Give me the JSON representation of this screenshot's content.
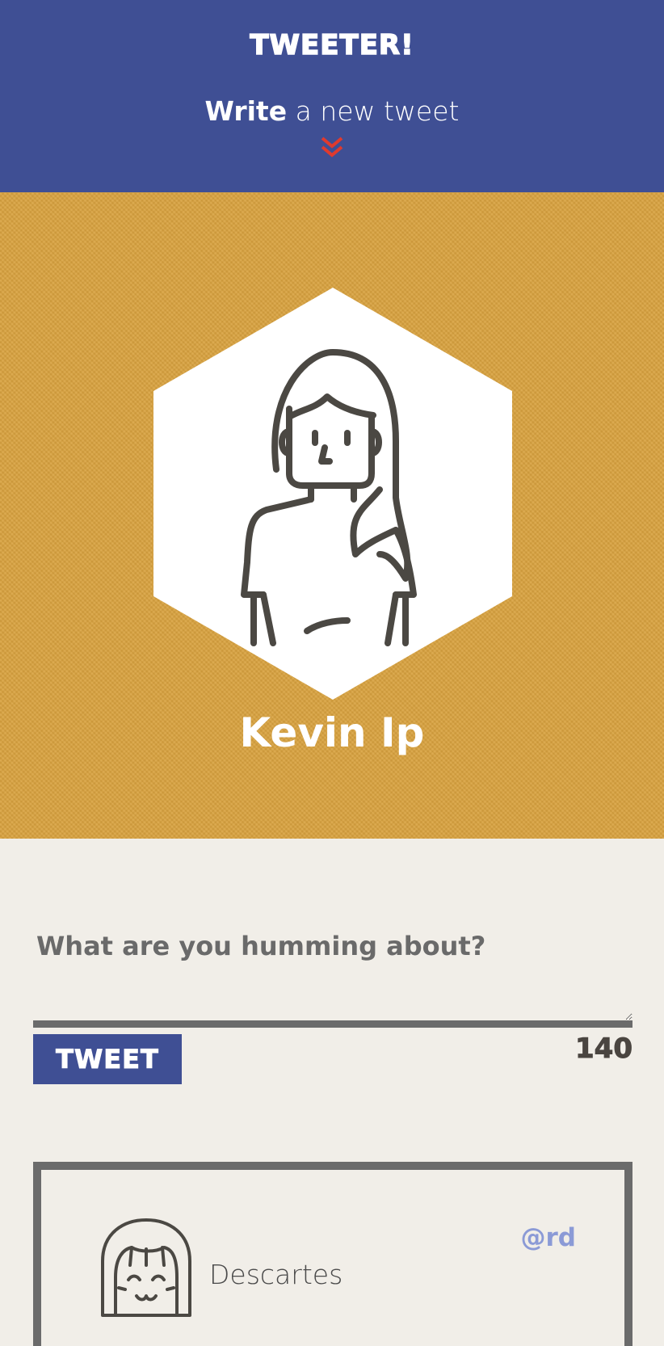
{
  "header": {
    "brand": "TWEETER!",
    "compose_bold": "Write",
    "compose_rest": " a new tweet"
  },
  "profile": {
    "name": "Kevin Ip"
  },
  "compose": {
    "placeholder": "What are you humming about?",
    "button_label": "TWEET",
    "char_count": "140"
  },
  "tweets": [
    {
      "name": "Descartes",
      "handle": "@rd"
    }
  ],
  "colors": {
    "nav_bg": "#3f4f94",
    "profile_bg": "#d9a23f",
    "page_bg": "#f1eee8",
    "chevron": "#e03a2e",
    "handle": "#8b9ad6"
  }
}
